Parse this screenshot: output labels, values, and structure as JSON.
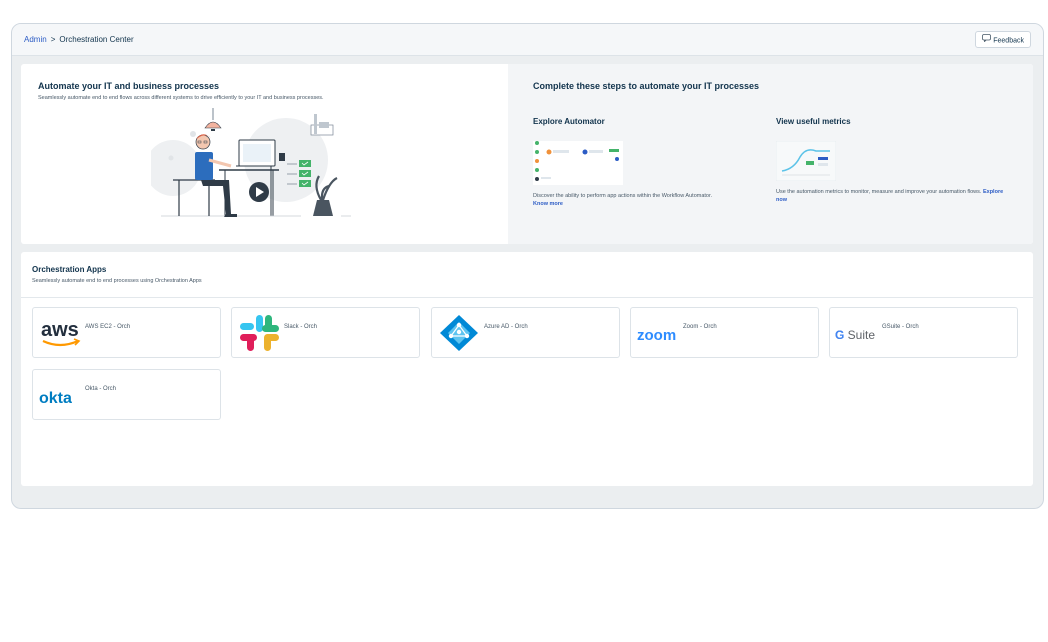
{
  "breadcrumb": {
    "admin": "Admin",
    "separator": ">",
    "current": "Orchestration Center"
  },
  "feedback_button": {
    "label": "Feedback",
    "icon": "chat-bubble-icon"
  },
  "hero": {
    "title": "Automate your IT and business processes",
    "subtitle": "Seamlessly automate end to end flows across different systems to drive efficiently to your IT and business processes.",
    "steps_title": "Complete these steps to automate your IT processes",
    "steps": [
      {
        "title": "Explore Automator",
        "description": "Discover the ability to perform app actions within the Workflow Automator.",
        "link": "Know more"
      },
      {
        "title": "View useful metrics",
        "description": "Use the automation metrics to monitor, measure and improve your automation flows.",
        "link": "Explore now"
      }
    ]
  },
  "orchestration": {
    "title": "Orchestration Apps",
    "subtitle": "Seamlessly automate end to end processes using Orchestration Apps",
    "apps": [
      {
        "name": "AWS EC2 - Orch",
        "logo_text": "aws"
      },
      {
        "name": "Slack - Orch",
        "logo_text": ""
      },
      {
        "name": "Azure AD - Orch",
        "logo_text": ""
      },
      {
        "name": "Zoom - Orch",
        "logo_text": "zoom"
      },
      {
        "name": "GSuite - Orch",
        "logo_text": "G Suite"
      },
      {
        "name": "Okta - Orch",
        "logo_text": "okta"
      }
    ]
  },
  "colors": {
    "link": "#2c5cc5",
    "text": "#12344d",
    "aws_orange": "#ff9900",
    "zoom_blue": "#2d8cff",
    "okta_blue": "#007dc1",
    "azure_blue": "#0089d6"
  }
}
